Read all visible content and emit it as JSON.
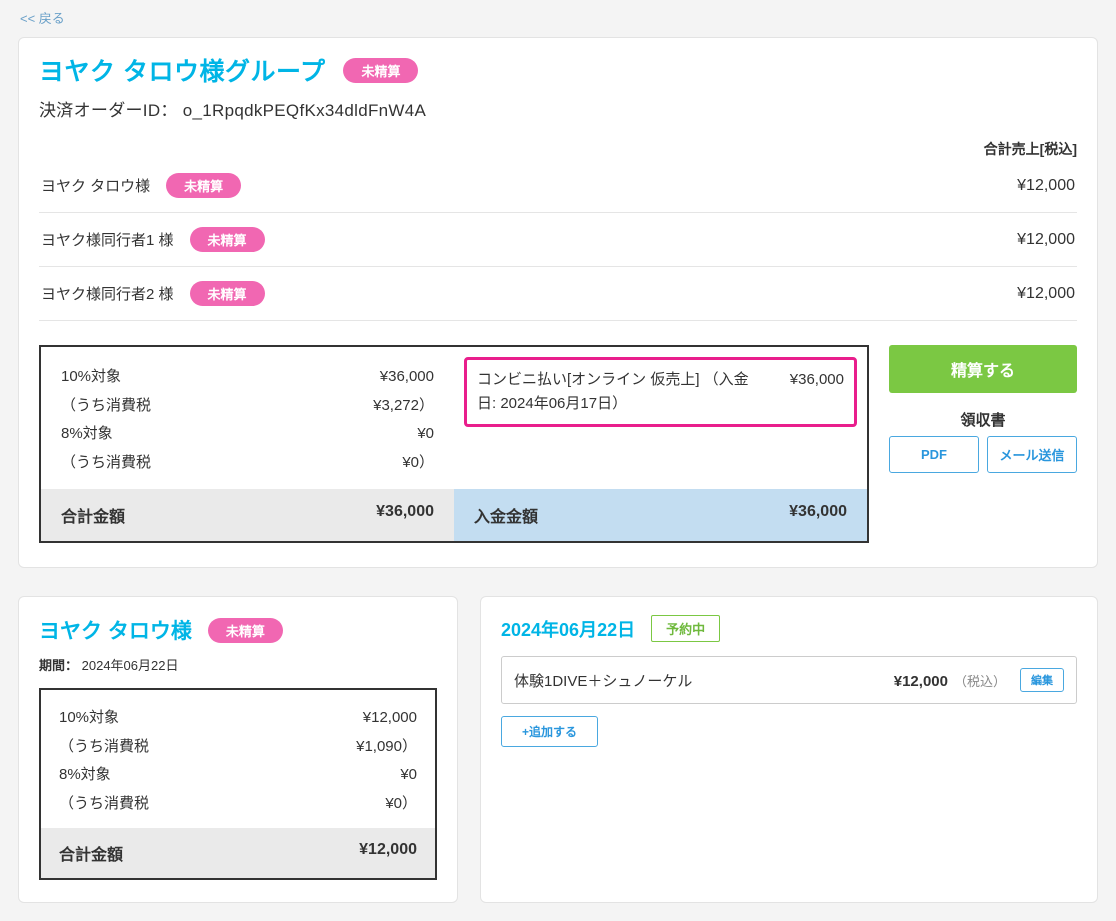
{
  "back": "<< 戻る",
  "group": {
    "title": "ヨヤク タロウ様グループ",
    "status": "未精算",
    "order_id_label": "決済オーダーID：",
    "order_id": "o_1RpqdkPEQfKx34dldFnW4A"
  },
  "total_header": "合計売上[税込]",
  "persons": [
    {
      "name": "ヨヤク タロウ様",
      "status": "未精算",
      "amount": "¥12,000"
    },
    {
      "name": "ヨヤク様同行者1 様",
      "status": "未精算",
      "amount": "¥12,000"
    },
    {
      "name": "ヨヤク様同行者2 様",
      "status": "未精算",
      "amount": "¥12,000"
    }
  ],
  "summary_left": {
    "r1l": "10%対象",
    "r1v": "¥36,000",
    "r2l": "（うち消費税",
    "r2v": "¥3,272）",
    "r3l": "8%対象",
    "r3v": "¥0",
    "r4l": "（うち消費税",
    "r4v": "¥0）",
    "total_label": "合計金額",
    "total_value": "¥36,000"
  },
  "summary_right": {
    "pay_text": "コンビニ払い[オンライン 仮売上] （入金日: 2024年06月17日）",
    "pay_amount": "¥36,000",
    "deposit_label": "入金金額",
    "deposit_value": "¥36,000"
  },
  "actions": {
    "settle": "精算する",
    "receipt": "領収書",
    "pdf": "PDF",
    "mail": "メール送信"
  },
  "individual": {
    "title": "ヨヤク タロウ様",
    "status": "未精算",
    "period_label": "期間：",
    "period_value": "2024年06月22日",
    "r1l": "10%対象",
    "r1v": "¥12,000",
    "r2l": "（うち消費税",
    "r2v": "¥1,090）",
    "r3l": "8%対象",
    "r3v": "¥0",
    "r4l": "（うち消費税",
    "r4v": "¥0）",
    "total_label": "合計金額",
    "total_value": "¥12,000"
  },
  "booking": {
    "date": "2024年06月22日",
    "status": "予約中",
    "item_name": "体験1DIVE＋シュノーケル",
    "price": "¥12,000",
    "tax_in": "（税込）",
    "edit": "編集",
    "add": "+追加する"
  }
}
